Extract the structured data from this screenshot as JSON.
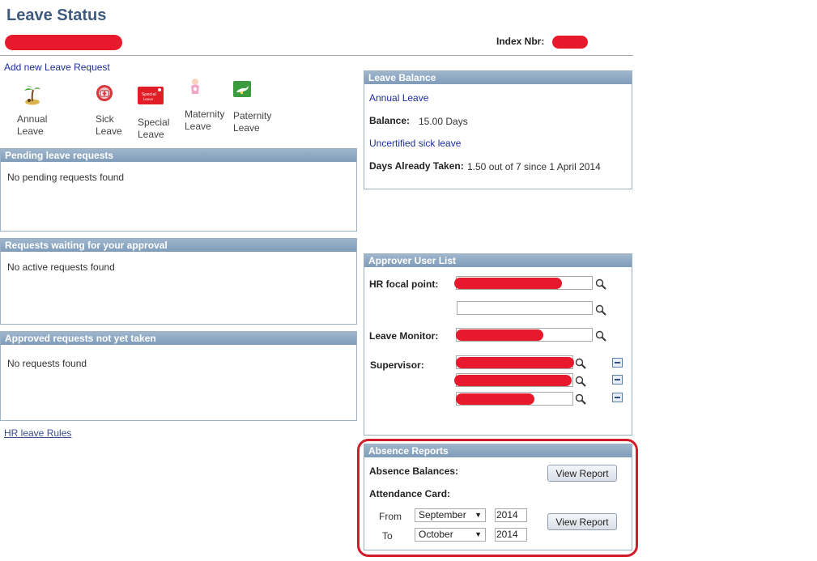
{
  "page": {
    "title": "Leave Status",
    "index_label": "Index Nbr:"
  },
  "add_request": {
    "link": "Add new Leave Request",
    "types": [
      {
        "line1": "Annual",
        "line2": "Leave",
        "icon": "palm-island-icon"
      },
      {
        "line1": "Sick",
        "line2": "Leave",
        "icon": "first-aid-icon"
      },
      {
        "line1": "Special",
        "line2": "Leave",
        "icon": "special-leave-card-icon"
      },
      {
        "line1": "Maternity",
        "line2": "Leave",
        "icon": "baby-icon"
      },
      {
        "line1": "Paternity",
        "line2": "Leave",
        "icon": "stork-icon"
      }
    ]
  },
  "pending": {
    "header": "Pending leave requests",
    "empty": "No pending requests found"
  },
  "waiting": {
    "header": "Requests waiting for your approval",
    "empty": "No active requests found"
  },
  "approved": {
    "header": "Approved requests not yet taken",
    "empty": "No requests found"
  },
  "rules_link": "HR leave Rules",
  "balance": {
    "header": "Leave Balance",
    "annual_title": "Annual Leave",
    "balance_label": "Balance:",
    "balance_value": "15.00 Days",
    "sick_title": "Uncertified sick leave",
    "taken_label": "Days Already Taken:",
    "taken_value": "1.50 out of 7 since 1 April 2014"
  },
  "approvers": {
    "header": "Approver User List",
    "hr_label": "HR focal point:",
    "monitor_label": "Leave Monitor:",
    "supervisor_label": "Supervisor:"
  },
  "reports": {
    "header": "Absence Reports",
    "balances_label": "Absence Balances:",
    "attendance_label": "Attendance Card:",
    "view_report": "View Report",
    "from_label": "From",
    "to_label": "To",
    "from_month": "September",
    "from_year": "2014",
    "to_month": "October",
    "to_year": "2014"
  },
  "colors": {
    "panel_header": "#8aa5c0",
    "link": "#1d2f9c",
    "redaction": "#e8192c",
    "highlight": "#d11b2a"
  }
}
